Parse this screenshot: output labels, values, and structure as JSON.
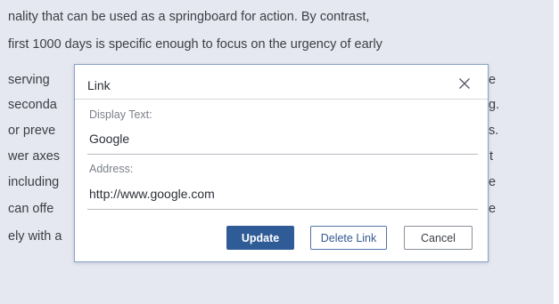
{
  "document": {
    "lines": [
      {
        "left": "nality that can be used as a springboard for action. By contrast,",
        "right": ""
      },
      {
        "left": "first 1000 days is specific enough to focus on the urgency of early",
        "right": ""
      },
      {
        "left": "serving",
        "right": "e"
      },
      {
        "left": "seconda",
        "right": "g."
      },
      {
        "left": "or preve",
        "right": "s."
      },
      {
        "left": "wer axes",
        "right": "t"
      },
      {
        "left": "including",
        "right": "e"
      },
      {
        "left": "can offe",
        "right": "e"
      },
      {
        "left": "ely with a",
        "right": ""
      }
    ]
  },
  "dialog": {
    "title": "Link",
    "close_icon": "close-icon",
    "display_text": {
      "label": "Display Text:",
      "value": "Google"
    },
    "address": {
      "label": "Address:",
      "value": "http://www.google.com"
    },
    "buttons": {
      "update": "Update",
      "delete": "Delete Link",
      "cancel": "Cancel"
    }
  },
  "colors": {
    "page_background": "#e6e8f1",
    "primary_button": "#2f5b97",
    "dialog_border": "#8aa2c6"
  }
}
